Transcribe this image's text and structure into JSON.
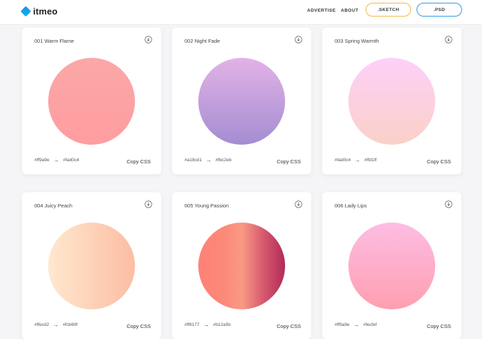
{
  "header": {
    "logo_text": "itmeo",
    "nav": [
      {
        "label": "ADVERTISE"
      },
      {
        "label": "ABOUT"
      }
    ],
    "sketch_button": ".SKETCH",
    "psd_button": ".PSD",
    "colors": {
      "sketch_border": "#f0b64d",
      "psd_border": "#2c9ae8",
      "logo_accent": "#1c90f2"
    }
  },
  "cards": [
    {
      "title": "001 Warm Flame",
      "from": "#ff9a9e",
      "to": "#fad0c4",
      "copy": "Copy CSS",
      "gradient_direction": "vertical"
    },
    {
      "title": "002 Night Fade",
      "from": "#a18cd1",
      "to": "#fbc2eb",
      "copy": "Copy CSS",
      "gradient_direction": "vertical"
    },
    {
      "title": "003 Spring Warmth",
      "from": "#fad0c4",
      "to": "#ffd1ff",
      "copy": "Copy CSS",
      "gradient_direction": "vertical"
    },
    {
      "title": "004 Juicy Peach",
      "from": "#ffecd2",
      "to": "#fcb69f",
      "copy": "Copy CSS",
      "gradient_direction": "horizontal"
    },
    {
      "title": "005 Young Passion",
      "from": "#ff8177",
      "to": "#b12a5b",
      "copy": "Copy CSS",
      "gradient_direction": "horizontal"
    },
    {
      "title": "006 Lady Lips",
      "from": "#ff9a9e",
      "to": "#fecfef",
      "copy": "Copy CSS",
      "gradient_direction": "vertical"
    }
  ],
  "icons": {
    "download": "download-circle-icon",
    "arrow": "arrow-right-icon"
  }
}
